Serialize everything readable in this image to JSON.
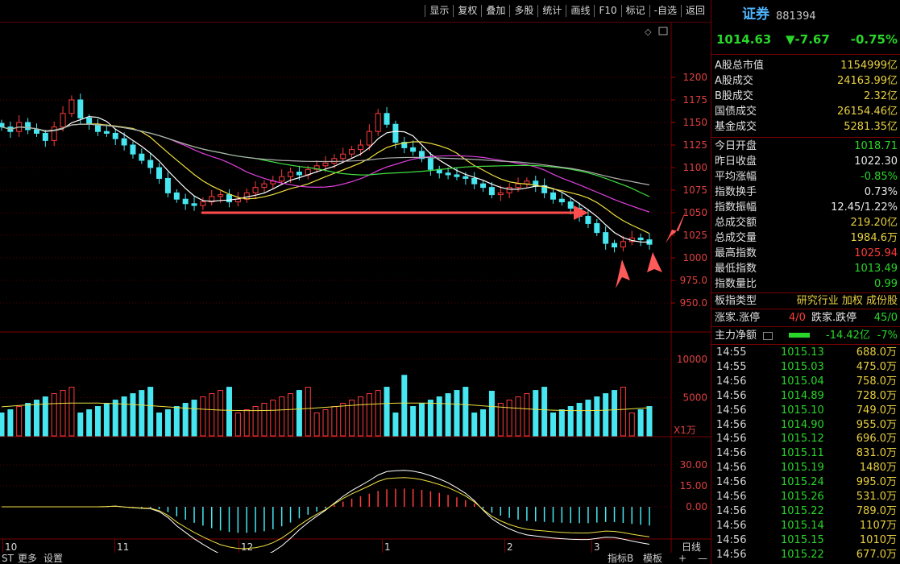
{
  "toolbar": {
    "buttons": [
      "显示",
      "复权",
      "叠加",
      "多股",
      "统计",
      "画线",
      "F10",
      "标记",
      "-自选",
      "返回"
    ]
  },
  "chart_data": {
    "type": "candlestick",
    "price_axis": {
      "ticks": [
        "1200",
        "1175",
        "1150",
        "1125",
        "1100",
        "1075",
        "1050",
        "1025",
        "1000",
        "975.0",
        "950.0"
      ],
      "values": [
        1200,
        1175,
        1150,
        1125,
        1100,
        1075,
        1050,
        1025,
        1000,
        975,
        950
      ]
    },
    "volume_axis": {
      "ticks": [
        "10000",
        "5000"
      ],
      "values": [
        10000,
        5000
      ],
      "unit": "X1万"
    },
    "macd_axis": {
      "ticks": [
        "30.00",
        "15.00",
        "0.00"
      ],
      "values": [
        30,
        15,
        0
      ]
    },
    "x_labels": [
      "10",
      "11",
      "12",
      "1",
      "2",
      "3"
    ],
    "period_label": "日线",
    "close_approx": [
      1145,
      1140,
      1150,
      1142,
      1138,
      1130,
      1145,
      1160,
      1175,
      1155,
      1148,
      1140,
      1138,
      1132,
      1125,
      1115,
      1108,
      1100,
      1088,
      1072,
      1065,
      1060,
      1058,
      1062,
      1068,
      1070,
      1062,
      1065,
      1072,
      1078,
      1082,
      1085,
      1090,
      1095,
      1092,
      1098,
      1102,
      1105,
      1110,
      1115,
      1120,
      1125,
      1140,
      1160,
      1148,
      1128,
      1122,
      1118,
      1110,
      1098,
      1094,
      1092,
      1090,
      1088,
      1082,
      1078,
      1070,
      1072,
      1078,
      1082,
      1085,
      1080,
      1072,
      1065,
      1062,
      1055,
      1046,
      1038,
      1028,
      1016,
      1012,
      1018,
      1022,
      1020,
      1015
    ]
  },
  "status_bar": {
    "items": [
      "ST",
      "更多",
      "设置"
    ],
    "right_items": [
      "指标B",
      "模板",
      "+",
      "—"
    ]
  },
  "sidebar": {
    "title": "证券",
    "code": "881394",
    "price": "1014.63",
    "change": "▼-7.67",
    "change_pct": "-0.75%",
    "stats_a": [
      {
        "label": "A股总市值",
        "value": "1154999亿"
      },
      {
        "label": "A股成交",
        "value": "24163.99亿"
      },
      {
        "label": "B股成交",
        "value": "2.32亿"
      },
      {
        "label": "国债成交",
        "value": "26154.46亿"
      },
      {
        "label": "基金成交",
        "value": "5281.35亿"
      }
    ],
    "stats_b": [
      {
        "label": "今日开盘",
        "value": "1018.71",
        "color": "#29d629"
      },
      {
        "label": "昨日收盘",
        "value": "1022.30",
        "color": "#e8e8e8"
      },
      {
        "label": "平均涨幅",
        "value": "-0.85%",
        "color": "#29d629"
      },
      {
        "label": "指数换手",
        "value": "0.73%",
        "color": "#e8e8e8"
      },
      {
        "label": "指数振幅",
        "value": "12.45/1.22%",
        "color": "#e8e8e8"
      },
      {
        "label": "总成交额",
        "value": "219.20亿",
        "color": "#e8d040"
      },
      {
        "label": "总成交量",
        "value": "1984.6万",
        "color": "#e8d040"
      },
      {
        "label": "最高指数",
        "value": "1025.94",
        "color": "#ff3b3b"
      },
      {
        "label": "最低指数",
        "value": "1013.49",
        "color": "#29d629"
      },
      {
        "label": "指数量比",
        "value": "0.99",
        "color": "#29d629"
      }
    ],
    "board_type_label": "板指类型",
    "board_type_value": "研究行业 加权 成份股",
    "updown_label": "涨家.涨停",
    "updown_value": "4/0",
    "down_label": "跌家.跌停",
    "down_value": "45/0",
    "netflow_label": "主力净额",
    "netflow_value": "-14.42亿",
    "netflow_pct": "-7%",
    "ticks": [
      {
        "t": "14:55",
        "p": "1015.13",
        "q": "688.0万"
      },
      {
        "t": "14:55",
        "p": "1015.03",
        "q": "475.0万"
      },
      {
        "t": "14:56",
        "p": "1015.04",
        "q": "758.0万"
      },
      {
        "t": "14:56",
        "p": "1014.89",
        "q": "728.0万"
      },
      {
        "t": "14:56",
        "p": "1015.10",
        "q": "749.0万"
      },
      {
        "t": "14:56",
        "p": "1014.90",
        "q": "955.0万"
      },
      {
        "t": "14:56",
        "p": "1015.12",
        "q": "696.0万"
      },
      {
        "t": "14:56",
        "p": "1015.11",
        "q": "831.0万"
      },
      {
        "t": "14:56",
        "p": "1015.19",
        "q": "1480万"
      },
      {
        "t": "14:56",
        "p": "1015.24",
        "q": "995.0万"
      },
      {
        "t": "14:56",
        "p": "1015.26",
        "q": "531.0万"
      },
      {
        "t": "14:56",
        "p": "1015.22",
        "q": "789.0万"
      },
      {
        "t": "14:56",
        "p": "1015.14",
        "q": "1107万"
      },
      {
        "t": "14:56",
        "p": "1015.15",
        "q": "1010万"
      },
      {
        "t": "14:56",
        "p": "1015.22",
        "q": "677.0万"
      }
    ]
  }
}
